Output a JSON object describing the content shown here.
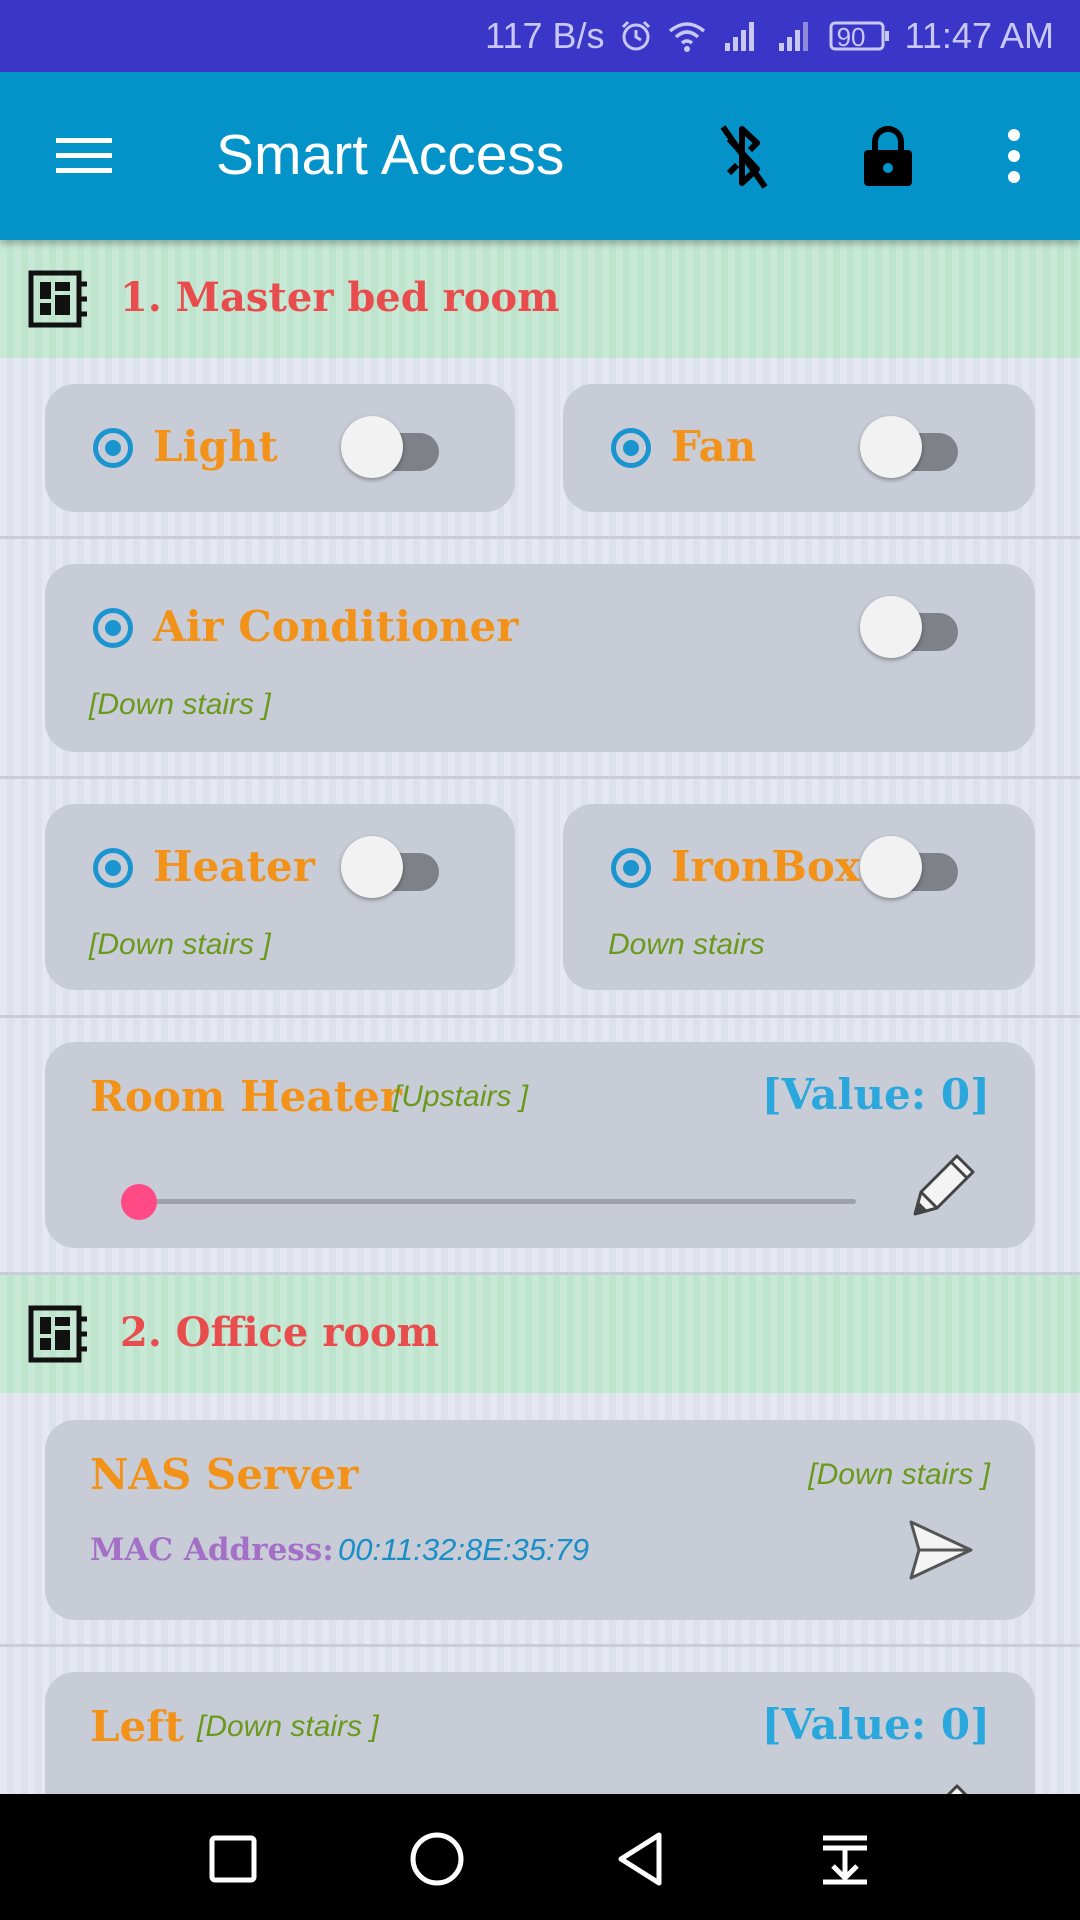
{
  "status_bar": {
    "net_speed": "117 B/s",
    "battery": "90",
    "time": "11:47 AM",
    "icons": [
      "alarm-icon",
      "wifi-icon",
      "signal-icon",
      "signal-icon",
      "battery-icon"
    ]
  },
  "app_bar": {
    "title": "Smart Access",
    "icons": [
      "menu-icon",
      "bluetooth-off-icon",
      "lock-icon",
      "more-vert-icon"
    ]
  },
  "sections": [
    {
      "title": "1. Master bed room",
      "icon": "dashboard-icon",
      "devices": [
        {
          "name": "Light",
          "location": "",
          "state": false
        },
        {
          "name": "Fan",
          "location": "",
          "state": false
        },
        {
          "name": "Air Conditioner",
          "location": "[Down stairs ]",
          "state": false
        },
        {
          "name": "Heater",
          "location": "[Down stairs ]",
          "state": false
        },
        {
          "name": "IronBox",
          "location": "Down stairs",
          "state": false
        }
      ],
      "slider": {
        "name": "Room Heater",
        "location": "[Upstairs ]",
        "value_text": "[Value: 0]",
        "value": 0
      }
    },
    {
      "title": "2. Office room",
      "icon": "dashboard-icon",
      "wol": {
        "name": "NAS Server",
        "location": "[Down stairs ]",
        "mac_label": "MAC Address:",
        "mac": "00:11:32:8E:35:79"
      },
      "slider": {
        "name": "Left",
        "location": "[Down stairs ]",
        "value_text": "[Value: 0]",
        "value": 0
      }
    }
  ],
  "colors": {
    "status_bar": "#3a36c8",
    "app_bar": "#0393c9",
    "section_title": "#e84c4c",
    "device_label": "#f39218",
    "location_text": "#6a9a1d",
    "value_text": "#2aa7dc",
    "mac_label": "#a46fc6",
    "slider_thumb": "#ff4a86"
  },
  "nav_bar": {
    "icons": [
      "recents-square-icon",
      "home-circle-icon",
      "back-triangle-icon",
      "notification-pull-icon"
    ]
  }
}
